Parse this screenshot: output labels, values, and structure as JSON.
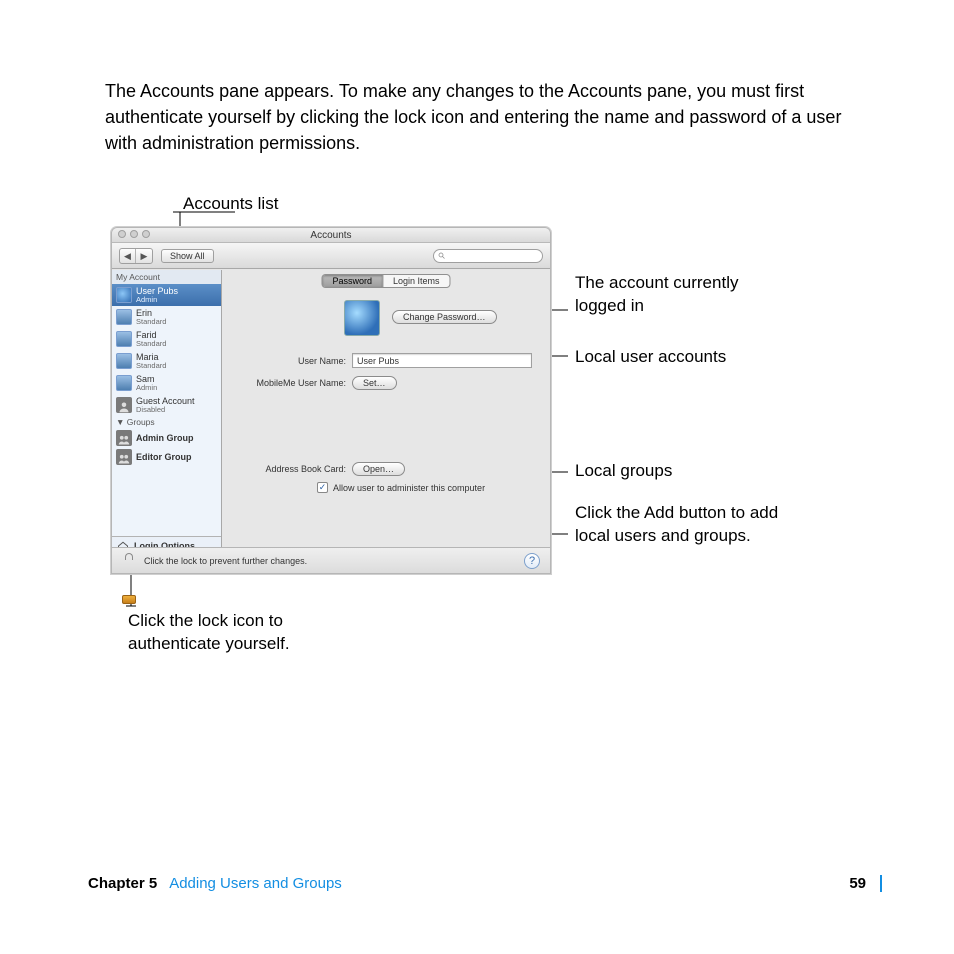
{
  "intro": "The Accounts pane appears. To make any changes to the Accounts pane, you must first authenticate yourself by clicking the lock icon and entering the name and password of a user with administration permissions.",
  "callouts": {
    "accounts_list": "Accounts list",
    "logged_in": "The account currently logged in",
    "local_users": "Local user accounts",
    "local_groups": "Local groups",
    "add_button": "Click the Add button to add local users and groups.",
    "lock": "Click the lock icon to authenticate yourself."
  },
  "window": {
    "title": "Accounts",
    "show_all": "Show All",
    "segments": {
      "password": "Password",
      "login_items": "Login Items"
    },
    "change_password": "Change Password…",
    "fields": {
      "user_name_label": "User Name:",
      "user_name_value": "User Pubs",
      "mobileme_label": "MobileMe User Name:",
      "mobileme_button": "Set…",
      "addressbook_label": "Address Book Card:",
      "addressbook_button": "Open…",
      "admin_checkbox": "Allow user to administer this computer"
    },
    "sidebar": {
      "my_account_label": "My Account",
      "current": {
        "name": "User Pubs",
        "role": "Admin"
      },
      "users": [
        {
          "name": "Erin",
          "role": "Standard"
        },
        {
          "name": "Farid",
          "role": "Standard"
        },
        {
          "name": "Maria",
          "role": "Standard"
        },
        {
          "name": "Sam",
          "role": "Admin"
        }
      ],
      "guest": {
        "name": "Guest Account",
        "role": "Disabled"
      },
      "groups_label": "Groups",
      "groups": [
        {
          "name": "Admin Group"
        },
        {
          "name": "Editor Group"
        }
      ],
      "login_options": "Login Options"
    },
    "lock_text": "Click the lock to prevent further changes."
  },
  "footer": {
    "chapter": "Chapter 5",
    "title": "Adding Users and Groups",
    "page": "59"
  }
}
